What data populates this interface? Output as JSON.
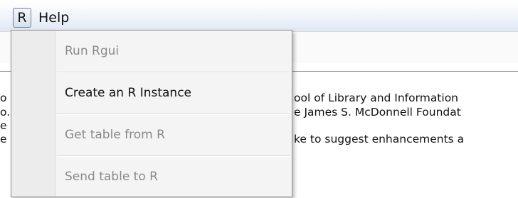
{
  "menubar": {
    "r_menu_label": "R",
    "help_menu_label": "Help"
  },
  "dropdown": {
    "items": [
      {
        "label": "Run Rgui",
        "enabled": false
      },
      {
        "label": "Create an R Instance",
        "enabled": true
      },
      {
        "label": "Get table from R",
        "enabled": false
      },
      {
        "label": "Send table to R",
        "enabled": false
      }
    ]
  },
  "document": {
    "left_fragments": [
      "o",
      "o.",
      "e",
      "e"
    ],
    "right_fragments": [
      "ool of Library and Information",
      "e James S. McDonnell Foundat",
      "ke to suggest enhancements a"
    ]
  },
  "colors": {
    "menubar_top": "#ffffff",
    "menubar_bottom": "#dfe8f4",
    "dropdown_bg": "#f4f4f4",
    "disabled_text": "#8a8a8a"
  }
}
